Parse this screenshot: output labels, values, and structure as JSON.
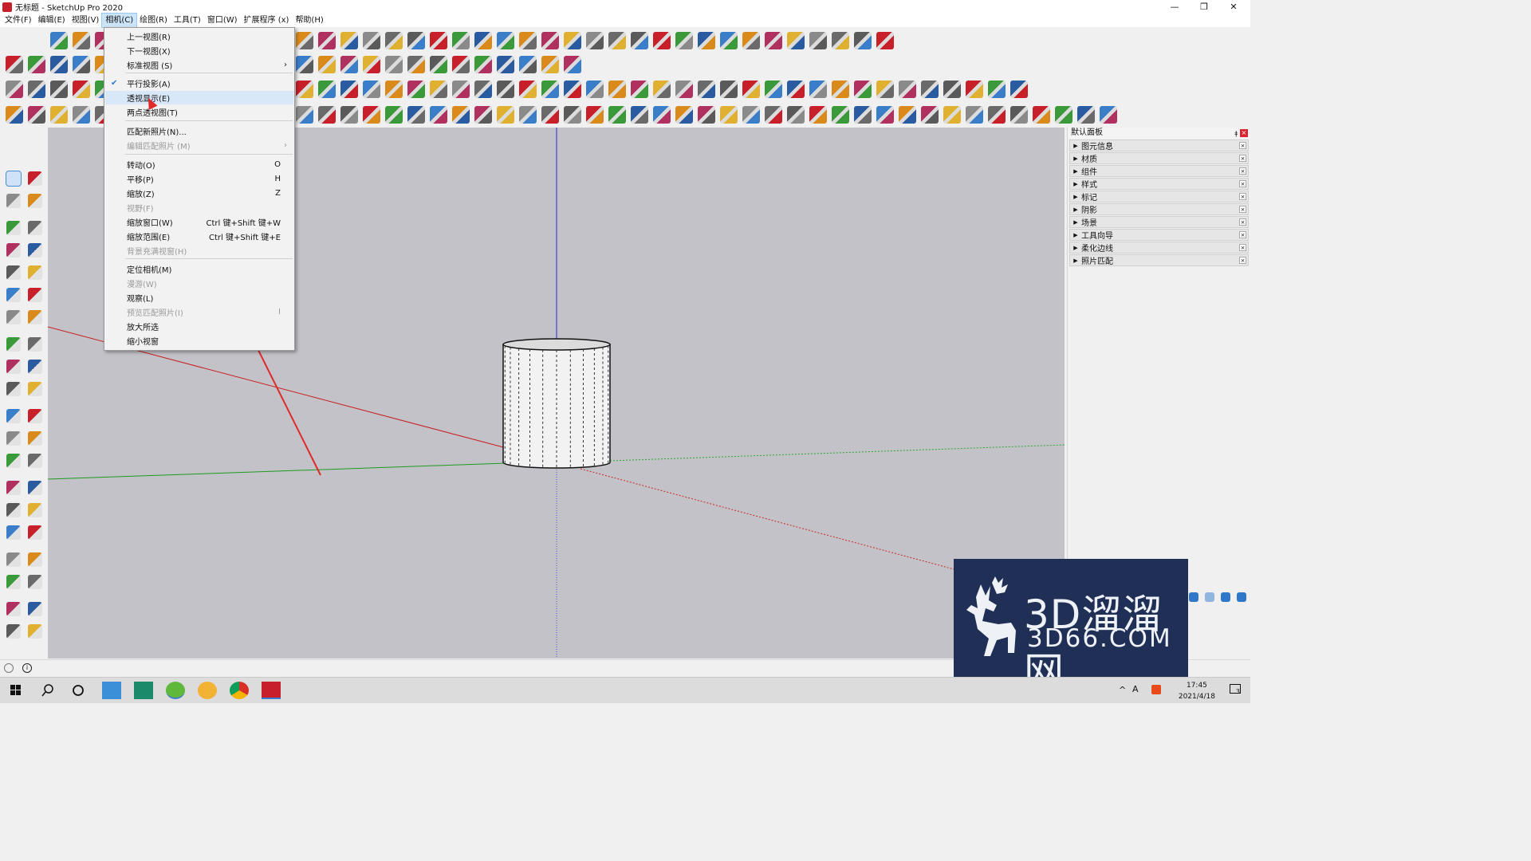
{
  "window": {
    "title": "无标题 - SketchUp Pro 2020"
  },
  "menubar": {
    "items": [
      "文件(F)",
      "编辑(E)",
      "视图(V)",
      "相机(C)",
      "绘图(R)",
      "工具(T)",
      "窗口(W)",
      "扩展程序 (x)",
      "帮助(H)"
    ],
    "active": "相机(C)"
  },
  "camera_menu": {
    "items": [
      {
        "label": "上一视图(R)",
        "shortcut": "",
        "enabled": true
      },
      {
        "label": "下一视图(X)",
        "shortcut": "",
        "enabled": true
      },
      {
        "label": "标准视图 (S)",
        "shortcut": "",
        "enabled": true,
        "submenu": true
      },
      {
        "label": "平行投影(A)",
        "shortcut": "",
        "enabled": true,
        "checked": true
      },
      {
        "label": "透视显示(E)",
        "shortcut": "",
        "enabled": true,
        "highlighted": true
      },
      {
        "label": "两点透视图(T)",
        "shortcut": "",
        "enabled": true
      },
      {
        "label": "匹配新照片(N)...",
        "shortcut": "",
        "enabled": true
      },
      {
        "label": "编辑匹配照片 (M)",
        "shortcut": "",
        "enabled": false,
        "submenu": true
      },
      {
        "label": "转动(O)",
        "shortcut": "O",
        "enabled": true
      },
      {
        "label": "平移(P)",
        "shortcut": "H",
        "enabled": true
      },
      {
        "label": "缩放(Z)",
        "shortcut": "Z",
        "enabled": true
      },
      {
        "label": "视野(F)",
        "shortcut": "",
        "enabled": false
      },
      {
        "label": "缩放窗口(W)",
        "shortcut": "Ctrl 键+Shift 键+W",
        "enabled": true
      },
      {
        "label": "缩放范围(E)",
        "shortcut": "Ctrl 键+Shift 键+E",
        "enabled": true
      },
      {
        "label": "背景充满视窗(H)",
        "shortcut": "",
        "enabled": false
      },
      {
        "label": "定位相机(M)",
        "shortcut": "",
        "enabled": true
      },
      {
        "label": "漫游(W)",
        "shortcut": "",
        "enabled": false
      },
      {
        "label": "观察(L)",
        "shortcut": "",
        "enabled": true
      },
      {
        "label": "预览匹配照片(I)",
        "shortcut": "I",
        "enabled": false
      },
      {
        "label": "放大所选",
        "shortcut": "",
        "enabled": true
      },
      {
        "label": "缩小视窗",
        "shortcut": "",
        "enabled": true
      }
    ]
  },
  "tray": {
    "title": "默认面板",
    "panels": [
      "图元信息",
      "材质",
      "组件",
      "样式",
      "标记",
      "阴影",
      "场景",
      "工具向导",
      "柔化边线",
      "照片匹配"
    ]
  },
  "watermark": {
    "line1": "3D溜溜网",
    "line2": "3D66.COM"
  },
  "taskbar": {
    "time": "17:45",
    "date": "2021/4/18",
    "notifications": "3"
  },
  "colors": {
    "viewport": "#c2c2c8",
    "menu_highlight": "#d8e8f8",
    "accent": "#c8202a",
    "watermark_bg": "#1f2f56"
  }
}
